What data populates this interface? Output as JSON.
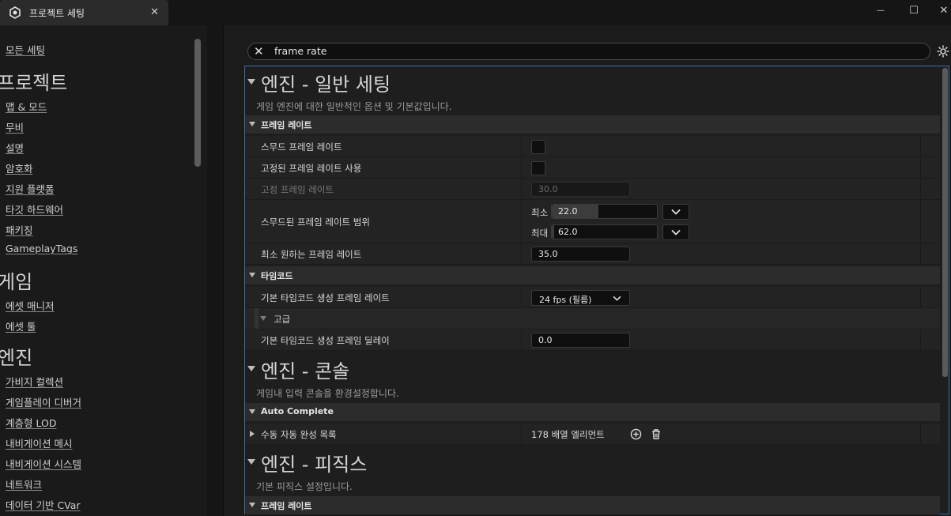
{
  "tab": {
    "title": "프로젝트 세팅",
    "close": "✕"
  },
  "window": {
    "minimize": "—",
    "maximize": "☐",
    "close": "✕"
  },
  "sidebar": {
    "all_settings": "모든 세팅",
    "groups": [
      {
        "title": "프로젝트",
        "items": [
          "맵 & 모드",
          "무비",
          "설명",
          "암호화",
          "지원 플랫폼",
          "타깃 하드웨어",
          "패키징",
          "GameplayTags"
        ]
      },
      {
        "title": "게임",
        "items": [
          "에셋 매니저",
          "에셋 툴"
        ]
      },
      {
        "title": "엔진",
        "items": [
          "가비지 컬렉션",
          "게임플레이 디버거",
          "계층형 LOD",
          "내비게이션 메시",
          "내비게이션 시스템",
          "네트워크",
          "데이터 기반 CVar"
        ]
      }
    ]
  },
  "search": {
    "clear": "✕",
    "query": "frame rate"
  },
  "sections": {
    "general": {
      "title": "엔진 - 일반 세팅",
      "desc": "게임 엔진에 대한 일반적인 옵션 및 기본값입니다.",
      "cat_framerate": "프레임 레이트",
      "smooth_framerate": "스무드 프레임 레이트",
      "use_fixed_framerate": "고정된 프레임 레이트 사용",
      "fixed_framerate": "고정 프레임 레이트",
      "fixed_framerate_value": "30.0",
      "smoothed_range": "스무드된 프레임 레이트 범위",
      "min_label": "최소",
      "min_value": "22.0",
      "min_fill": 0.44,
      "max_label": "최대",
      "max_value": "62.0",
      "max_fill": 0.02,
      "min_desired": "최소 원하는 프레임 레이트",
      "min_desired_value": "35.0",
      "cat_timecode": "타임코드",
      "default_timecode_rate": "기본 타임코드 생성 프레임 레이트",
      "default_timecode_rate_value": "24 fps (필름)",
      "advanced": "고급",
      "default_timecode_delay": "기본 타임코드 생성 프레임 딜레이",
      "default_timecode_delay_value": "0.0"
    },
    "console": {
      "title": "엔진 - 콘솔",
      "desc": "게임내 입력 콘솔을 환경설정합니다.",
      "cat_autocomplete": "Auto Complete",
      "manual_list": "수동 자동 완성 목록",
      "manual_list_value": "178 배열 엘리먼트"
    },
    "physics": {
      "title": "엔진 - 피직스",
      "desc": "기본 피직스 설정입니다.",
      "cat_framerate": "프레임 레이트"
    }
  },
  "icons": {
    "logo": "unreal-logo-icon",
    "gear": "gear-icon",
    "add": "plus-circle-icon",
    "delete": "trash-icon"
  },
  "colors": {
    "accent_border": "#3a6ea8",
    "background": "#151515"
  }
}
